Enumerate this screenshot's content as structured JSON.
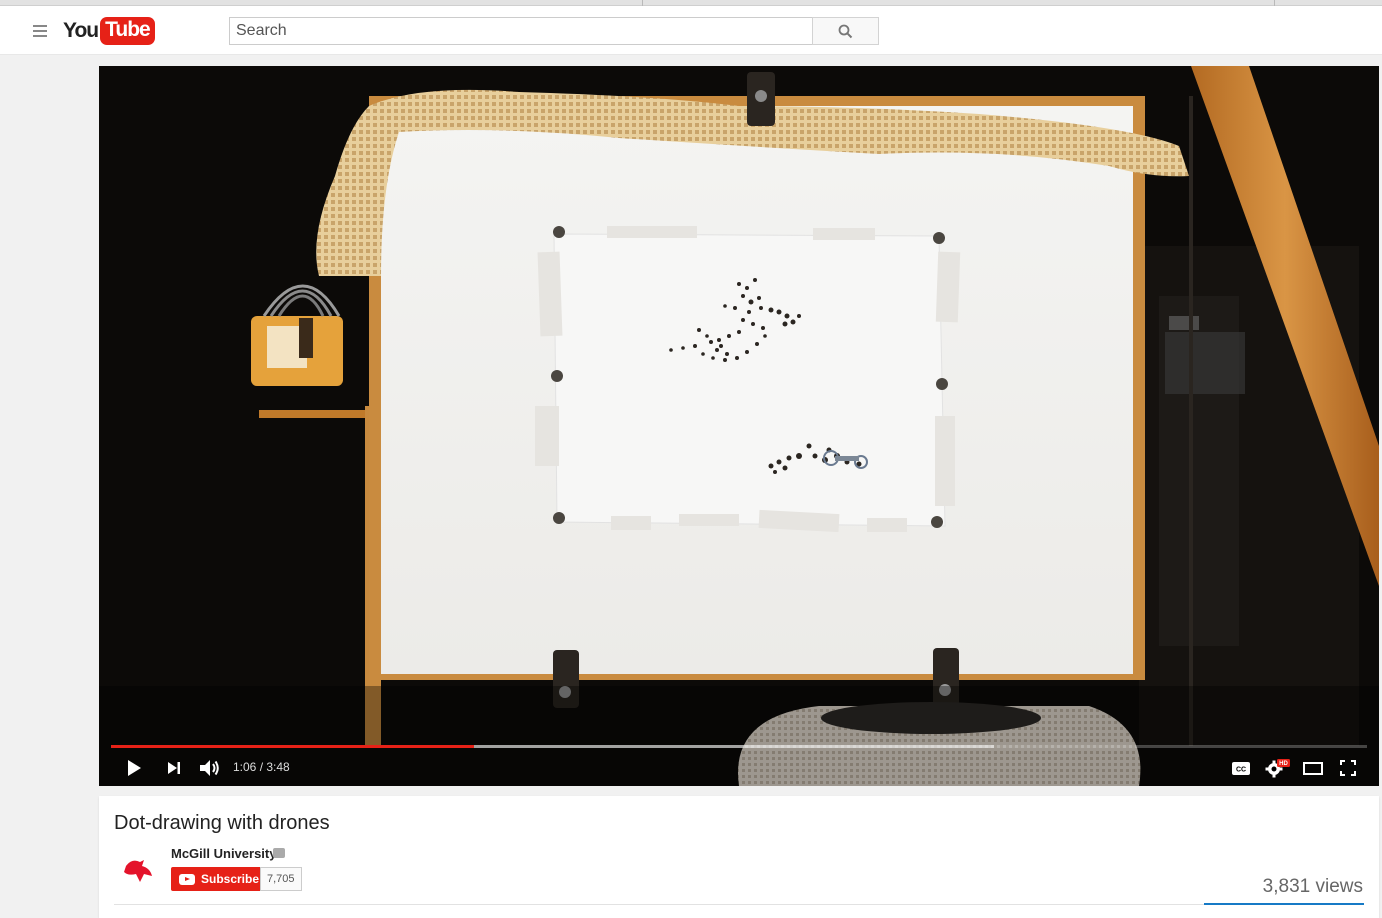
{
  "header": {
    "logo_you": "You",
    "logo_tube": "Tube",
    "search_placeholder": "Search"
  },
  "player": {
    "current_time": "1:06",
    "duration": "3:48",
    "time_display": "1:06 / 3:48",
    "progress_played_fraction": 0.289,
    "progress_loaded_fraction": 0.703,
    "hd_badge": "HD",
    "cc_label": "CC",
    "colors": {
      "progress": "#e62117"
    }
  },
  "video": {
    "title": "Dot-drawing with drones",
    "channel_name": "McGill University",
    "subscribe_label": "Subscribe",
    "subscriber_count": "7,705",
    "view_count": "3,831 views"
  },
  "icons": {
    "guide": "hamburger-menu-icon",
    "search": "magnifier-icon",
    "play": "play-icon",
    "next": "skip-next-icon",
    "volume": "volume-icon",
    "captions": "cc-icon",
    "settings": "gear-icon",
    "theater": "theater-mode-icon",
    "fullscreen": "fullscreen-icon"
  },
  "colors": {
    "brand_red": "#e62117",
    "link_blue": "#167ac6"
  }
}
